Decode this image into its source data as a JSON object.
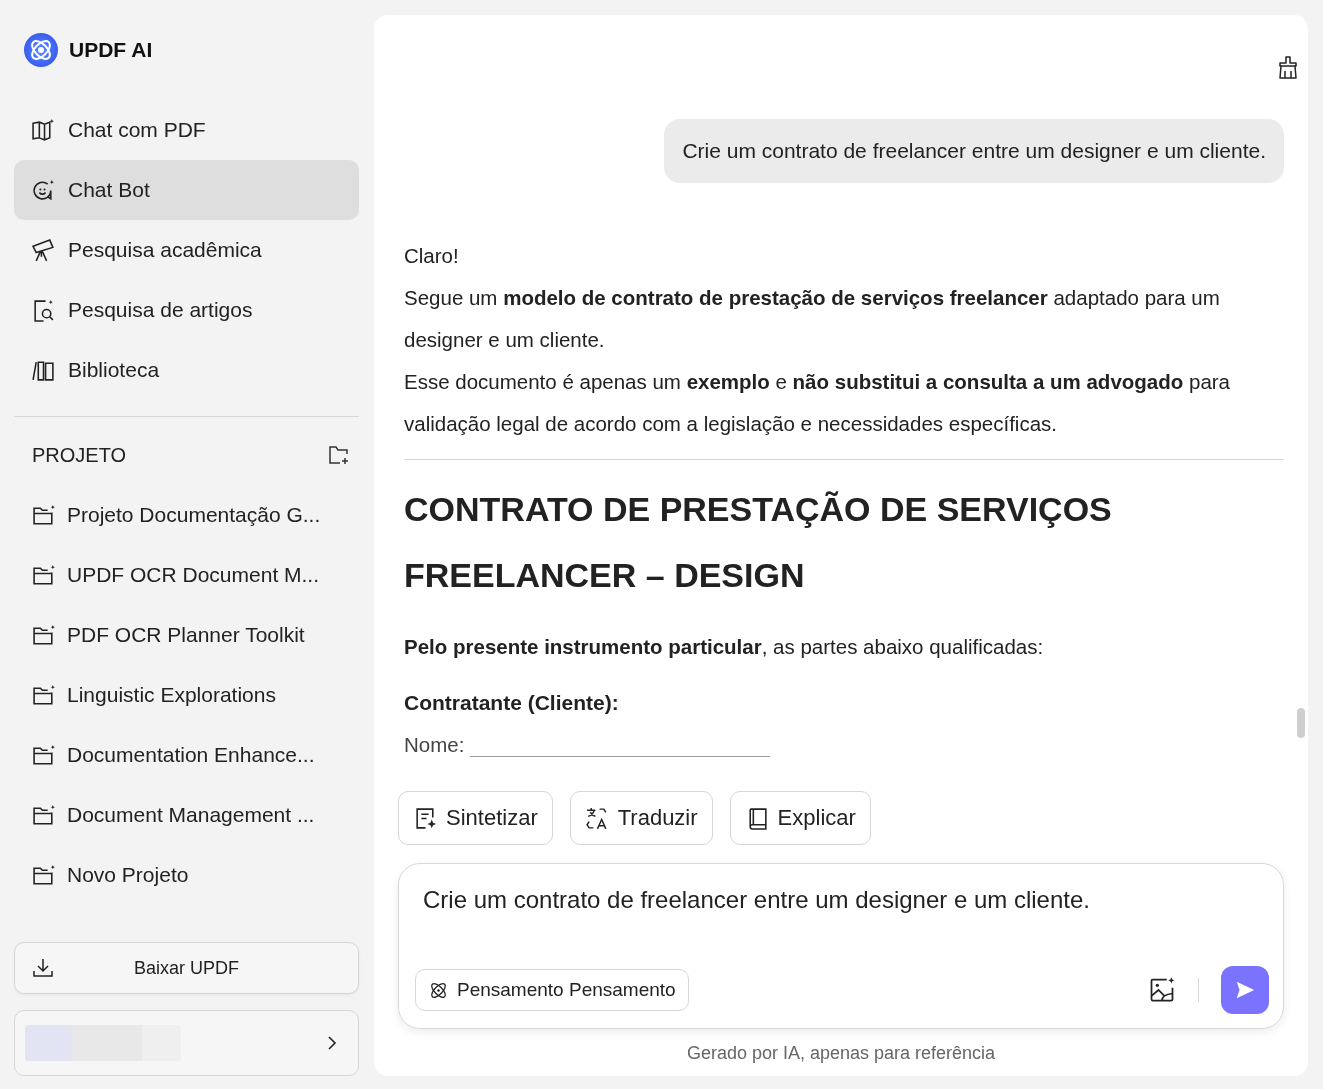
{
  "app": {
    "name": "UPDF AI"
  },
  "nav": [
    {
      "label": "Chat com PDF",
      "kind": "book",
      "selected": false
    },
    {
      "label": "Chat Bot",
      "kind": "bot",
      "selected": true
    },
    {
      "label": "Pesquisa acadêmica",
      "kind": "telescope",
      "selected": false
    },
    {
      "label": "Pesquisa de artigos",
      "kind": "search",
      "selected": false
    },
    {
      "label": "Biblioteca",
      "kind": "library",
      "selected": false
    }
  ],
  "projects": {
    "title": "PROJETO",
    "items": [
      "Projeto Documentação G...",
      "UPDF OCR Document M...",
      "PDF OCR Planner Toolkit",
      "Linguistic Explorations",
      "Documentation Enhance...",
      "Document Management ...",
      "Novo Projeto"
    ]
  },
  "download_button": "Baixar UPDF",
  "chat": {
    "user_message": "Crie um contrato de freelancer entre um designer e um cliente.",
    "reply": [
      "Claro!",
      "Segue um **modelo de contrato de prestação de serviços freelancer** adaptado para um designer e um cliente.",
      "Esse documento é apenas um **exemplo** e **não substitui a consulta a um advogado** para validação legal de acordo com a legislação e necessidades específicas."
    ],
    "heading_lines": [
      "CONTRATO DE PRESTAÇÃO DE SERVIÇOS",
      "FREELANCER – DESIGN"
    ],
    "intro": "**Pelo presente instrumento particular**, as partes abaixo qualificadas:",
    "party_title": "Contratante (Cliente):",
    "field_label": "Nome:"
  },
  "actions": [
    {
      "label": "Sintetizar",
      "kind": "summary"
    },
    {
      "label": "Traduzir",
      "kind": "translate"
    },
    {
      "label": "Explicar",
      "kind": "book"
    }
  ],
  "composer": {
    "value": "Crie um contrato de freelancer entre um designer e um cliente.",
    "mode_button": "Pensamento Pensamento"
  },
  "footer_note": "Gerado por IA, apenas para referência"
}
